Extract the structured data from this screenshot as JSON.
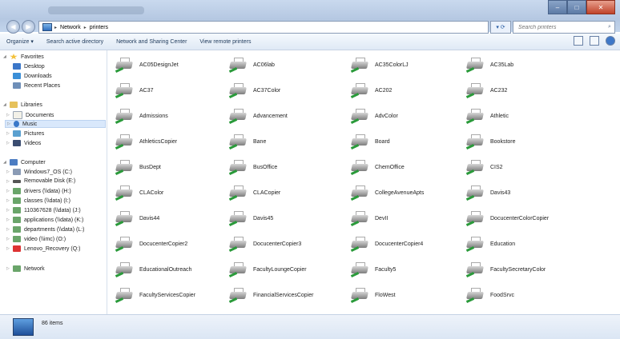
{
  "breadcrumb": {
    "segments": [
      "Network",
      "printers"
    ]
  },
  "search": {
    "placeholder": "Search printers"
  },
  "toolbar": {
    "organize": "Organize ▾",
    "items": [
      "Search active directory",
      "Network and Sharing Center",
      "View remote printers"
    ]
  },
  "nav": {
    "favorites": {
      "label": "Favorites",
      "items": [
        "Desktop",
        "Downloads",
        "Recent Places"
      ]
    },
    "libraries": {
      "label": "Libraries",
      "items": [
        "Documents",
        "Music",
        "Pictures",
        "Videos"
      ]
    },
    "computer": {
      "label": "Computer",
      "items": [
        "Windows7_OS (C:)",
        "Removable Disk (E:)",
        "drivers (\\\\data) (H:)",
        "classes (\\\\data) (I:)",
        "110367628 (\\\\data) (J:)",
        "applications (\\\\data) (K:)",
        "departments (\\\\data) (L:)",
        "video (\\\\imc) (O:)",
        "Lenovo_Recovery (Q:)"
      ]
    },
    "network": {
      "label": "Network"
    }
  },
  "printers": [
    "AC05DesignJet",
    "AC06lab",
    "AC35ColorLJ",
    "AC35Lab",
    "AC37",
    "AC37Color",
    "AC202",
    "AC232",
    "Admissions",
    "Advancement",
    "AdvColor",
    "Athletic",
    "AthleticsCopier",
    "Bane",
    "Board",
    "Bookstore",
    "BusDept",
    "BusOffice",
    "ChemOffice",
    "CIS2",
    "CLAColor",
    "CLACopier",
    "CollegeAvenueApts",
    "Davis43",
    "Davis44",
    "Davis45",
    "DevII",
    "DocucenterColorCopier",
    "DocucenterCopier2",
    "DocucenterCopier3",
    "DocucenterCopier4",
    "Education",
    "EducationalOutreach",
    "FacultyLoungeCopier",
    "Faculty5",
    "FacultySecretaryColor",
    "FacultyServicesCopier",
    "FinancialServicesCopier",
    "FloWest",
    "FoodSrvc"
  ],
  "status": {
    "count": "86 items"
  }
}
